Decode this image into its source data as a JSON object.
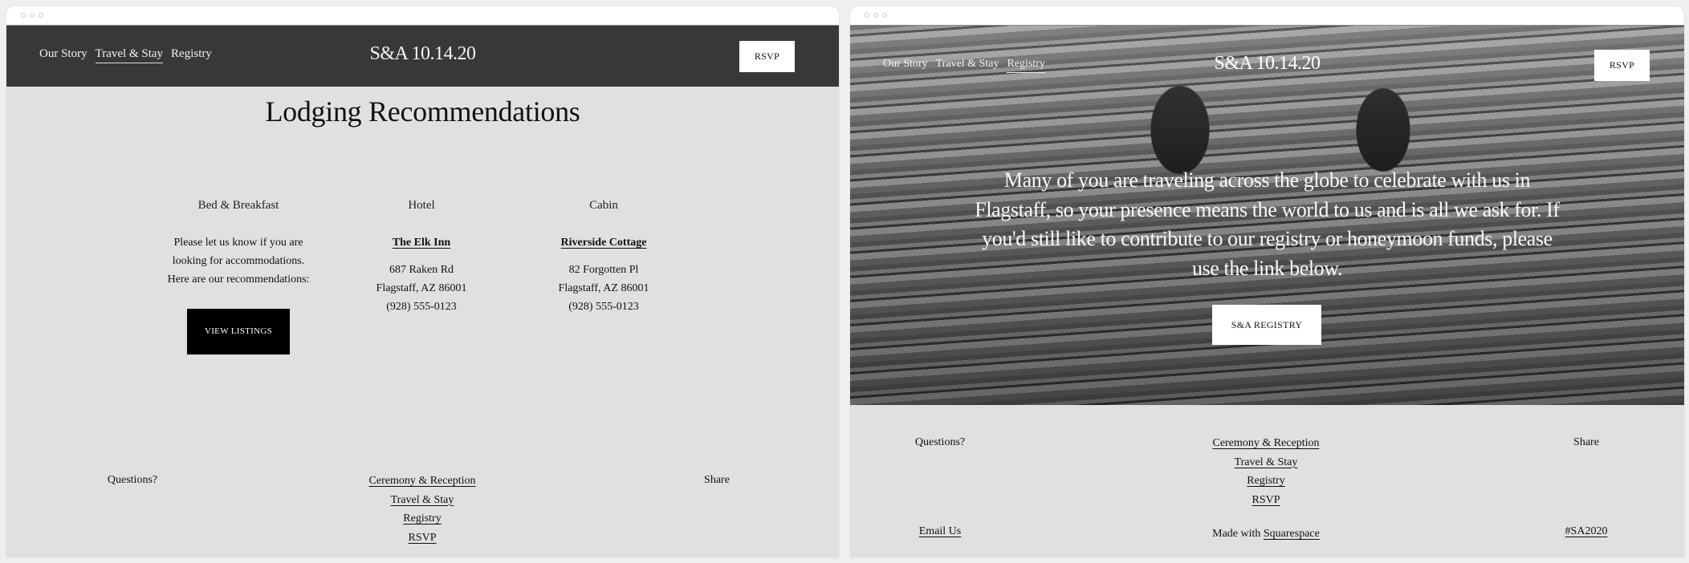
{
  "left": {
    "nav": [
      {
        "label": "Our Story",
        "active": false
      },
      {
        "label": "Travel & Stay",
        "active": true
      },
      {
        "label": "Registry",
        "active": false
      }
    ],
    "brand": "S&A 10.14.20",
    "rsvp": "RSVP",
    "title": "Lodging Recommendations",
    "columns": {
      "bnb": {
        "heading": "Bed & Breakfast",
        "lines": [
          "Please let us know if you are",
          "looking for accommodations.",
          "Here are our recommendations:"
        ],
        "button": "VIEW LISTINGS"
      },
      "hotel": {
        "heading": "Hotel",
        "name": "The Elk Inn",
        "lines": [
          "687 Raken Rd",
          "Flagstaff, AZ 86001",
          "(928) 555-0123"
        ]
      },
      "cabin": {
        "heading": "Cabin",
        "name": "Riverside Cottage",
        "lines": [
          "82 Forgotten Pl",
          "Flagstaff, AZ 86001",
          "(928) 555-0123"
        ]
      }
    },
    "footer": {
      "questions": "Questions?",
      "links": [
        "Ceremony & Reception",
        "Travel & Stay",
        "Registry",
        "RSVP"
      ],
      "share": "Share"
    }
  },
  "right": {
    "nav": [
      {
        "label": "Our Story",
        "active": false
      },
      {
        "label": "Travel & Stay",
        "active": false
      },
      {
        "label": "Registry",
        "active": true
      }
    ],
    "brand": "S&A 10.14.20",
    "rsvp": "RSVP",
    "hero_text": "Many of you are traveling across the globe to celebrate with us in Flagstaff, so your presence means the world to us and is all we ask for. If you'd still like to contribute to our registry or honeymoon funds, please use the link below.",
    "registry_button": "S&A REGISTRY",
    "footer": {
      "questions": "Questions?",
      "links": [
        "Ceremony & Reception",
        "Travel & Stay",
        "Registry",
        "RSVP"
      ],
      "share": "Share",
      "email": "Email Us",
      "made_with_prefix": "Made with ",
      "made_with_link": "Squarespace",
      "hashtag": "#SA2020"
    }
  }
}
